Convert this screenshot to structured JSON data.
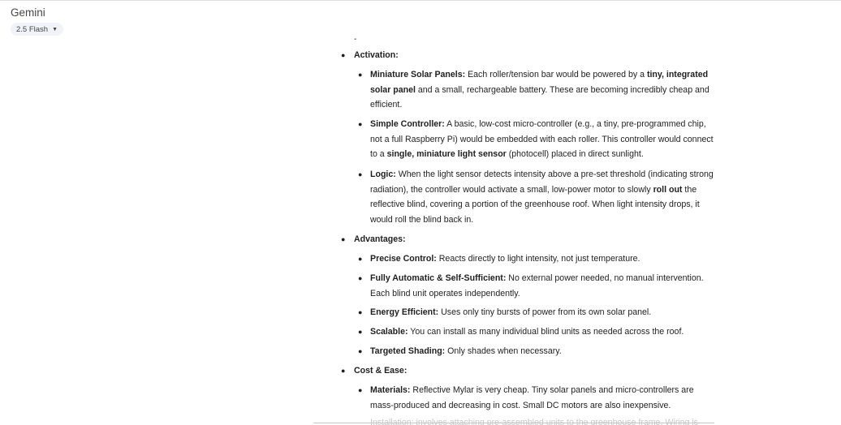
{
  "header": {
    "app_title": "Gemini",
    "model_label": "2.5 Flash"
  },
  "response": {
    "dash": "-",
    "activation": {
      "title": "Activation:",
      "items": [
        {
          "bold": "Miniature Solar Panels:",
          "t1": " Each roller/tension bar would be powered by a ",
          "b2": "tiny, integrated solar panel",
          "t2": " and a small, rechargeable battery. These are becoming incredibly cheap and efficient."
        },
        {
          "bold": "Simple Controller:",
          "t1": " A basic, low-cost micro-controller (e.g., a tiny, pre-programmed chip, not a full Raspberry Pi) would be embedded with each roller. This controller would connect to a ",
          "b2": "single, miniature light sensor",
          "t2": " (photocell) placed in direct sunlight."
        },
        {
          "bold": "Logic:",
          "t1": " When the light sensor detects intensity above a pre-set threshold (indicating strong radiation), the controller would activate a small, low-power motor to slowly ",
          "b2": "roll out",
          "t2": " the reflective blind, covering a portion of the greenhouse roof. When light intensity drops, it would roll the blind back in."
        }
      ]
    },
    "advantages": {
      "title": "Advantages:",
      "items": [
        {
          "bold": "Precise Control:",
          "text": " Reacts directly to light intensity, not just temperature."
        },
        {
          "bold": "Fully Automatic & Self-Sufficient:",
          "text": " No external power needed, no manual intervention. Each blind unit operates independently."
        },
        {
          "bold": "Energy Efficient:",
          "text": " Uses only tiny bursts of power from its own solar panel."
        },
        {
          "bold": "Scalable:",
          "text": " You can install as many individual blind units as needed across the roof."
        },
        {
          "bold": "Targeted Shading:",
          "text": " Only shades when necessary."
        }
      ]
    },
    "cost_ease": {
      "title": "Cost & Ease:",
      "items": [
        {
          "bold": "Materials:",
          "text": " Reflective Mylar is very cheap. Tiny solar panels and micro-controllers are mass-produced and decreasing in cost. Small DC motors are also inexpensive."
        }
      ],
      "cut_off_line": "Installation: involves attaching pre-assembled units to the greenhouse frame. Wiring is"
    }
  }
}
